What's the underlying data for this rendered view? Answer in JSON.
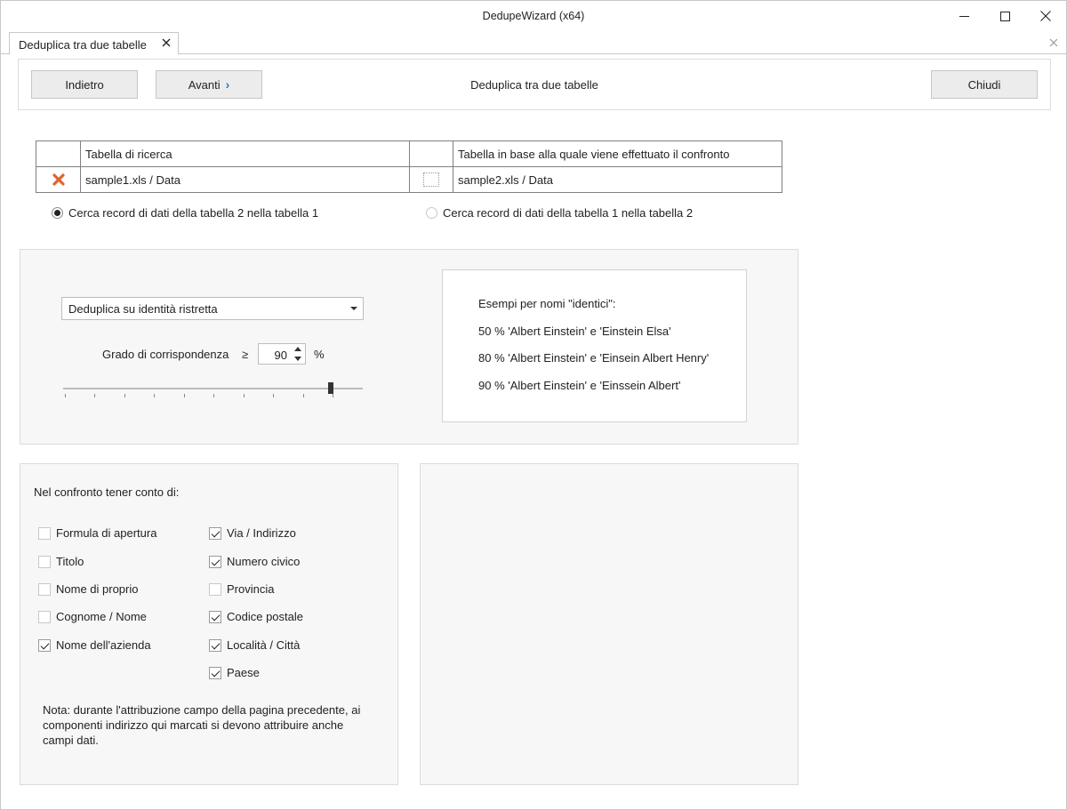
{
  "window": {
    "title": "DedupeWizard  (x64)"
  },
  "tab": {
    "label": "Deduplica tra due tabelle"
  },
  "toolbar": {
    "back_label": "Indietro",
    "next_label": "Avanti",
    "center_title": "Deduplica tra due tabelle",
    "close_label": "Chiudi"
  },
  "tables": {
    "header_search": "Tabella di ricerca",
    "header_compare": "Tabella in base alla quale viene effettuato il confronto",
    "search_value": "sample1.xls / Data",
    "compare_value": "sample2.xls / Data"
  },
  "direction": {
    "option1": "Cerca record di dati della tabella 2 nella tabella 1",
    "option2": "Cerca record di dati della tabella 1 nella tabella 2",
    "selected": 1
  },
  "match": {
    "mode_selected": "Deduplica su identità ristretta",
    "degree_label": "Grado di corrispondenza",
    "operator": "≥",
    "value": "90",
    "unit": "%",
    "slider_level_percent": 90
  },
  "examples": {
    "heading": "Esempi per nomi \"identici\":",
    "lines": [
      "50 %  'Albert Einstein' e 'Einstein Elsa'",
      "80 %  'Albert Einstein' e 'Einsein Albert Henry'",
      "90 %  'Albert Einstein' e 'Einssein Albert'"
    ]
  },
  "compare_fields": {
    "heading": "Nel confronto tener conto di:",
    "left": [
      {
        "label": "Formula di apertura",
        "checked": false
      },
      {
        "label": "Titolo",
        "checked": false
      },
      {
        "label": "Nome di proprio",
        "checked": false
      },
      {
        "label": "Cognome / Nome",
        "checked": false
      },
      {
        "label": "Nome dell'azienda",
        "checked": true
      }
    ],
    "right": [
      {
        "label": "Via / Indirizzo",
        "checked": true
      },
      {
        "label": "Numero civico",
        "checked": true
      },
      {
        "label": "Provincia",
        "checked": false
      },
      {
        "label": "Codice postale",
        "checked": true
      },
      {
        "label": "Località / Città",
        "checked": true
      },
      {
        "label": "Paese",
        "checked": true
      }
    ],
    "note": "Nota: durante l'attribuzione campo della pagina precedente, ai componenti indirizzo qui marcati si devono attribuire anche campi dati."
  },
  "colors": {
    "remove_icon": "#e0642a",
    "accent": "#1f7fd0"
  }
}
